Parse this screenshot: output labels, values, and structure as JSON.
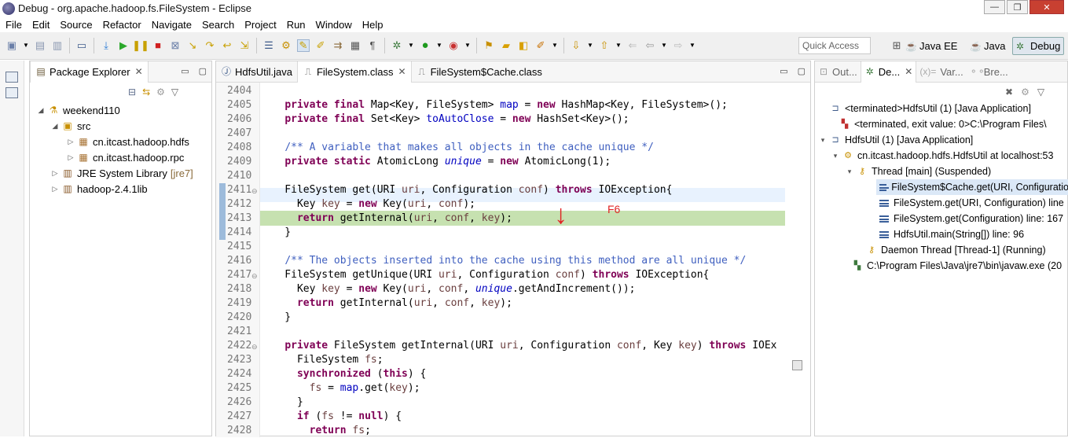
{
  "window": {
    "title": "Debug - org.apache.hadoop.fs.FileSystem - Eclipse",
    "min": "—",
    "max": "❐",
    "close": "✕"
  },
  "menu": [
    "File",
    "Edit",
    "Source",
    "Refactor",
    "Navigate",
    "Search",
    "Project",
    "Run",
    "Window",
    "Help"
  ],
  "quick_access": {
    "placeholder": "Quick Access"
  },
  "perspectives": [
    {
      "label": "Java EE",
      "icon": "java-ee-icon"
    },
    {
      "label": "Java",
      "icon": "java-icon"
    },
    {
      "label": "Debug",
      "icon": "debug-icon",
      "active": true
    }
  ],
  "package_explorer": {
    "tab": "Package Explorer",
    "tree": [
      {
        "label": "weekend110",
        "level": 0,
        "expanded": true,
        "icon": "project-icon"
      },
      {
        "label": "src",
        "level": 1,
        "expanded": true,
        "icon": "source-folder-icon"
      },
      {
        "label": "cn.itcast.hadoop.hdfs",
        "level": 2,
        "expanded": false,
        "icon": "package-icon"
      },
      {
        "label": "cn.itcast.hadoop.rpc",
        "level": 2,
        "expanded": false,
        "icon": "package-icon"
      },
      {
        "label": "JRE System Library",
        "suffix": "[jre7]",
        "level": 1,
        "expanded": false,
        "icon": "library-icon"
      },
      {
        "label": "hadoop-2.4.1lib",
        "level": 1,
        "expanded": false,
        "icon": "library-icon"
      }
    ]
  },
  "editor": {
    "tabs": [
      {
        "label": "HdfsUtil.java",
        "icon": "java-file-icon",
        "selected": false
      },
      {
        "label": "FileSystem.class",
        "icon": "class-file-icon",
        "selected": true,
        "close": "✕"
      },
      {
        "label": "FileSystem$Cache.class",
        "icon": "class-file-icon",
        "selected": false
      }
    ],
    "line_numbers": [
      "2404",
      "2405",
      "2406",
      "2407",
      "2408",
      "2409",
      "2410",
      "2411",
      "2412",
      "2413",
      "2414",
      "2415",
      "2416",
      "2417",
      "2418",
      "2419",
      "2420",
      "2421",
      "2422",
      "2423",
      "2424",
      "2425",
      "2426",
      "2427",
      "2428"
    ],
    "annotation": "F6",
    "annotation_arrow": "↓"
  },
  "debug": {
    "tabs": [
      {
        "label": "Out...",
        "icon": "outline-icon"
      },
      {
        "label": "De...",
        "icon": "debug-view-icon",
        "selected": true,
        "close": "✕"
      },
      {
        "label": "Var...",
        "icon": "variables-icon"
      },
      {
        "label": "Bre...",
        "icon": "breakpoints-icon"
      }
    ],
    "tree": [
      {
        "label": "<terminated>HdfsUtil (1) [Java Application]",
        "level": 0,
        "icon": "java-app-icon",
        "arrow": ""
      },
      {
        "label": "<terminated, exit value: 0>C:\\Program Files\\",
        "level": 1,
        "icon": "terminated-process-icon",
        "arrow": ""
      },
      {
        "label": "HdfsUtil (1) [Java Application]",
        "level": 0,
        "icon": "java-app-icon",
        "arrow": "▾"
      },
      {
        "label": "cn.itcast.hadoop.hdfs.HdfsUtil at localhost:53",
        "level": 1,
        "icon": "debug-target-icon",
        "arrow": "▾"
      },
      {
        "label": "Thread [main] (Suspended)",
        "level": 2,
        "icon": "thread-suspended-icon",
        "arrow": "▾"
      },
      {
        "label": "FileSystem$Cache.get(URI, Configuratio",
        "level": 3,
        "icon": "stack-frame-icon",
        "selected": true
      },
      {
        "label": "FileSystem.get(URI, Configuration) line",
        "level": 3,
        "icon": "stack-frame-icon"
      },
      {
        "label": "FileSystem.get(Configuration) line: 167",
        "level": 3,
        "icon": "stack-frame-icon"
      },
      {
        "label": "HdfsUtil.main(String[]) line: 96",
        "level": 3,
        "icon": "stack-frame-icon"
      },
      {
        "label": "Daemon Thread [Thread-1] (Running)",
        "level": 2,
        "icon": "thread-running-icon"
      },
      {
        "label": "C:\\Program Files\\Java\\jre7\\bin\\javaw.exe (20",
        "level": 1,
        "icon": "process-icon"
      }
    ]
  }
}
